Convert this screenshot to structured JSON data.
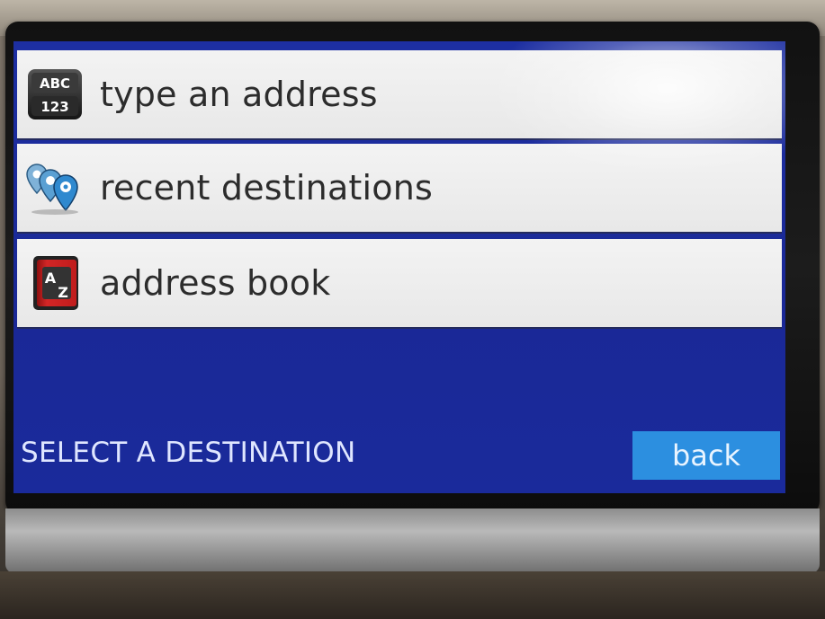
{
  "screen": {
    "title": "SELECT A DESTINATION",
    "back_label": "back"
  },
  "menu": {
    "items": [
      {
        "label": "type an address",
        "icon": "abc-123-keyboard-icon"
      },
      {
        "label": "recent destinations",
        "icon": "map-pins-icon"
      },
      {
        "label": "address book",
        "icon": "address-book-a-z-icon"
      }
    ]
  },
  "icon_text": {
    "abc": "ABC",
    "num": "123",
    "a": "A",
    "z": "Z"
  },
  "colors": {
    "screen_bg": "#1d2fa2",
    "item_bg": "#f3f3f3",
    "back_button_bg": "#2c8fe0",
    "title_text": "#dfe6ff"
  }
}
